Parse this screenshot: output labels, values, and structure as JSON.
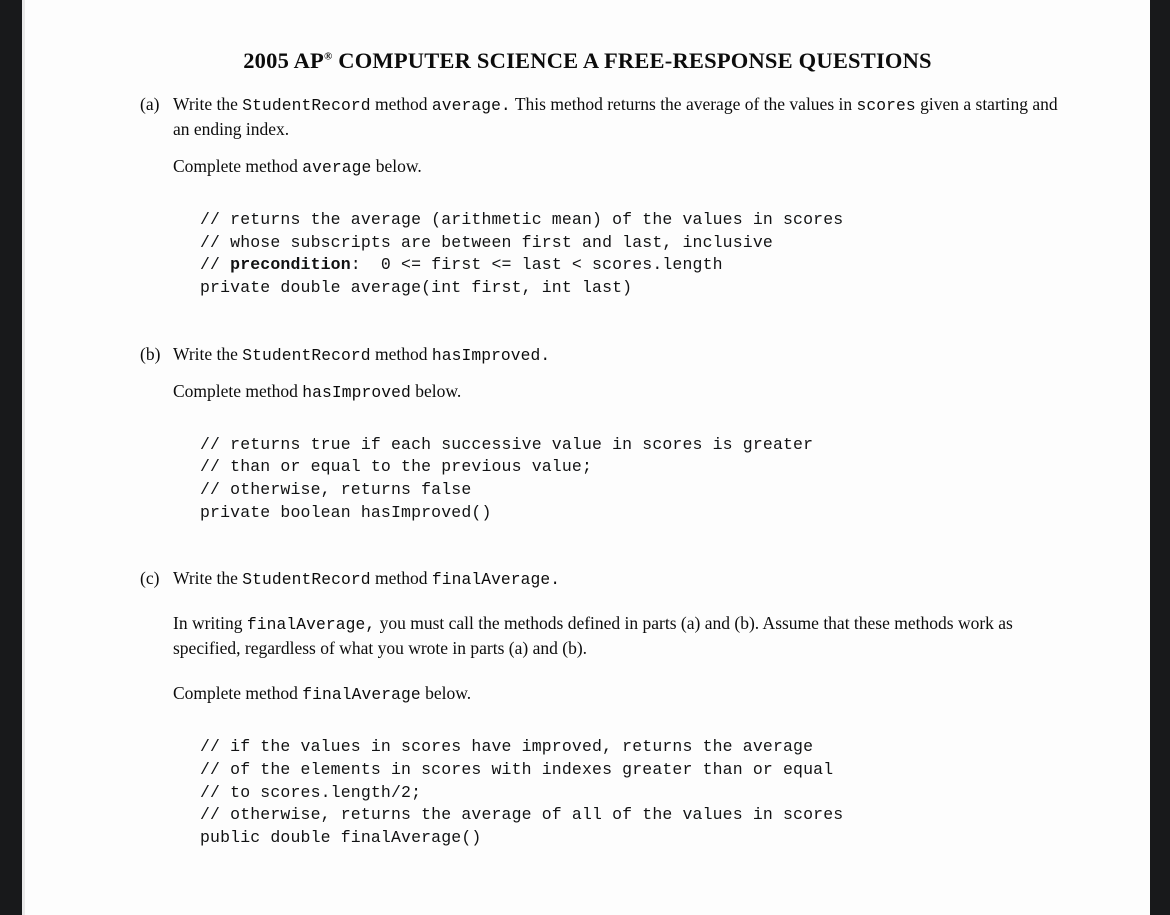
{
  "document": {
    "title_year": "2005 AP",
    "title_sup": "®",
    "title_rest": " COMPUTER SCIENCE A FREE-RESPONSE QUESTIONS",
    "title_full": "2005 AP® COMPUTER SCIENCE A FREE-RESPONSE QUESTIONS"
  },
  "parts": [
    {
      "label": "(a)",
      "prompt_pre": "Write the ",
      "prompt_class": "StudentRecord",
      "prompt_mid": " method ",
      "prompt_method": "average.",
      "prompt_post": "  This method returns the average of the values in ",
      "prompt_var": "scores",
      "prompt_tail": "  given a starting and an ending index.",
      "complete_pre": "Complete method ",
      "complete_method": "average",
      "complete_post": " below.",
      "code": "// returns the average (arithmetic mean) of the values in scores\n// whose subscripts are between first and last, inclusive\n// precondition:  0 <= first <= last < scores.length\nprivate double average(int first, int last)",
      "code_lines": [
        "// returns the average (arithmetic mean) of the values in scores",
        "// whose subscripts are between first and last, inclusive",
        "// precondition:  0 <= first <= last < scores.length",
        "private double average(int first, int last)"
      ],
      "code_bold_token": "precondition",
      "code_l3_prefix": "// ",
      "code_l3_suffix": ":  0 <= first <= last < scores.length"
    },
    {
      "label": "(b)",
      "prompt_pre": "Write the ",
      "prompt_class": "StudentRecord",
      "prompt_mid": " method ",
      "prompt_method": "hasImproved.",
      "prompt_post": "",
      "prompt_var": "",
      "prompt_tail": "",
      "complete_pre": "Complete method ",
      "complete_method": "hasImproved",
      "complete_post": " below.",
      "code_lines": [
        "// returns true if each successive value in scores is greater",
        "// than or equal to the previous value;",
        "// otherwise, returns false",
        "private boolean hasImproved()"
      ]
    },
    {
      "label": "(c)",
      "prompt_pre": "Write the ",
      "prompt_class": "StudentRecord",
      "prompt_mid": " method ",
      "prompt_method": "finalAverage.",
      "prompt_post": "",
      "prompt_var": "",
      "prompt_tail": "",
      "note_pre": "In writing ",
      "note_method": "finalAverage,",
      "note_post": "  you must call the methods defined in parts (a) and (b). Assume that these methods work as specified, regardless of what you wrote in parts (a) and (b).",
      "complete_pre": "Complete method ",
      "complete_method": "finalAverage",
      "complete_post": " below.",
      "code_lines": [
        "// if the values in scores have improved, returns the average",
        "// of the elements in scores with indexes greater than or equal",
        "// to scores.length/2;",
        "// otherwise, returns the average of all of the values in scores",
        "public double finalAverage()"
      ]
    }
  ],
  "colors": {
    "page_background": "#fdfdfd",
    "border_band": "#18191b",
    "text": "#0c0c0c",
    "code_text": "#111213"
  }
}
